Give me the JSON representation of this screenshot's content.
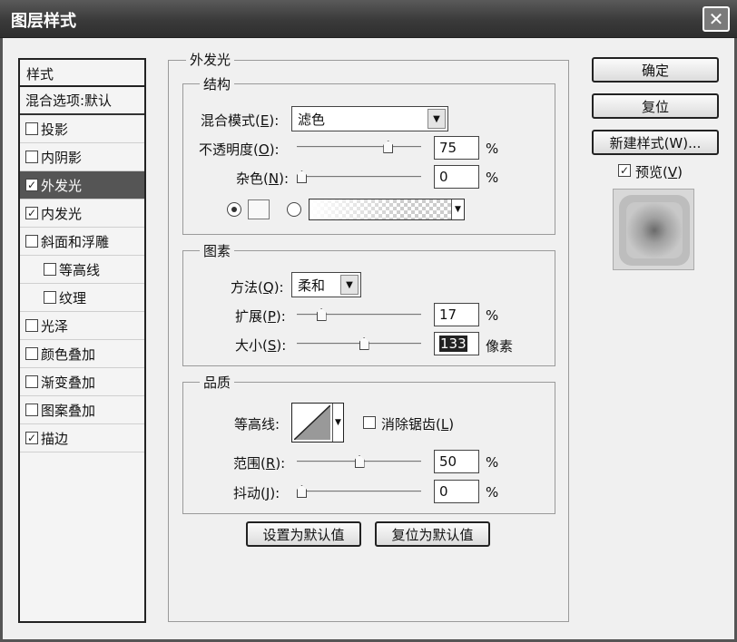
{
  "window": {
    "title": "图层样式",
    "close_label": "✕"
  },
  "styles": {
    "header": "样式",
    "items": [
      {
        "label": "混合选项:默认",
        "checked": null,
        "selected": false,
        "sub": false
      },
      {
        "label": "投影",
        "checked": false,
        "selected": false,
        "sub": false
      },
      {
        "label": "内阴影",
        "checked": false,
        "selected": false,
        "sub": false
      },
      {
        "label": "外发光",
        "checked": true,
        "selected": true,
        "sub": false
      },
      {
        "label": "内发光",
        "checked": true,
        "selected": false,
        "sub": false
      },
      {
        "label": "斜面和浮雕",
        "checked": false,
        "selected": false,
        "sub": false
      },
      {
        "label": "等高线",
        "checked": false,
        "selected": false,
        "sub": true
      },
      {
        "label": "纹理",
        "checked": false,
        "selected": false,
        "sub": true
      },
      {
        "label": "光泽",
        "checked": false,
        "selected": false,
        "sub": false
      },
      {
        "label": "颜色叠加",
        "checked": false,
        "selected": false,
        "sub": false
      },
      {
        "label": "渐变叠加",
        "checked": false,
        "selected": false,
        "sub": false
      },
      {
        "label": "图案叠加",
        "checked": false,
        "selected": false,
        "sub": false
      },
      {
        "label": "描边",
        "checked": true,
        "selected": false,
        "sub": false
      }
    ]
  },
  "panel": {
    "title": "外发光",
    "structure": {
      "title": "结构",
      "blend_mode": {
        "label": "混合模式",
        "key": "E",
        "value": "滤色"
      },
      "opacity": {
        "label": "不透明度",
        "key": "O",
        "value": "75",
        "unit": "%",
        "level": 0.75
      },
      "noise": {
        "label": "杂色",
        "key": "N",
        "value": "0",
        "unit": "%",
        "level": 0
      },
      "color_mode": "solid"
    },
    "elements": {
      "title": "图素",
      "technique": {
        "label": "方法",
        "key": "Q",
        "value": "柔和"
      },
      "spread": {
        "label": "扩展",
        "key": "P",
        "value": "17",
        "unit": "%",
        "level": 0.17
      },
      "size": {
        "label": "大小",
        "key": "S",
        "value": "133",
        "unit": "像素",
        "level": 0.54
      }
    },
    "quality": {
      "title": "品质",
      "contour": {
        "label": "等高线:"
      },
      "antialias": {
        "label": "消除锯齿",
        "key": "L",
        "checked": false
      },
      "range": {
        "label": "范围",
        "key": "R",
        "value": "50",
        "unit": "%",
        "level": 0.5
      },
      "jitter": {
        "label": "抖动",
        "key": "J",
        "value": "0",
        "unit": "%",
        "level": 0
      }
    },
    "make_default": "设置为默认值",
    "reset_default": "复位为默认值"
  },
  "buttons": {
    "ok": "确定",
    "reset": "复位",
    "new_style": "新建样式(W)...",
    "preview_label": "预览",
    "preview_key": "V",
    "preview_checked": true
  },
  "colors": {
    "titlebar": "#3a3a3a",
    "selection": "#555555",
    "background": "#f0f0f0"
  }
}
